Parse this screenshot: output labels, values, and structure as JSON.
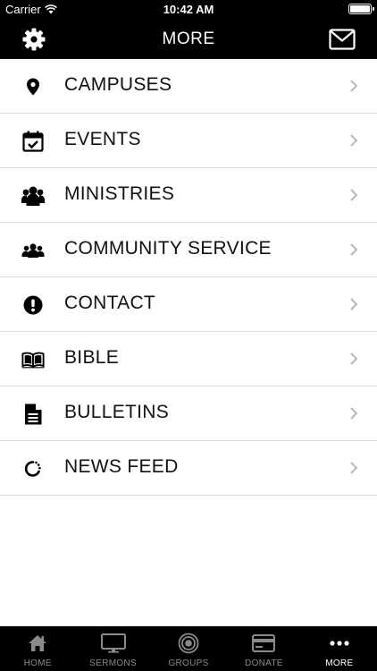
{
  "status": {
    "carrier": "Carrier",
    "time": "10:42 AM"
  },
  "nav": {
    "title": "MORE",
    "left_icon": "gear-icon",
    "right_icon": "mail-icon"
  },
  "menu": {
    "items": [
      {
        "label": "CAMPUSES",
        "icon": "map-pin-icon"
      },
      {
        "label": "EVENTS",
        "icon": "calendar-check-icon"
      },
      {
        "label": "MINISTRIES",
        "icon": "users-group-icon"
      },
      {
        "label": "COMMUNITY SERVICE",
        "icon": "people-icon"
      },
      {
        "label": "CONTACT",
        "icon": "exclamation-circle-icon"
      },
      {
        "label": "BIBLE",
        "icon": "open-book-icon"
      },
      {
        "label": "BULLETINS",
        "icon": "document-icon"
      },
      {
        "label": "NEWS FEED",
        "icon": "refresh-spinner-icon"
      }
    ]
  },
  "tabs": [
    {
      "label": "HOME",
      "icon": "home-icon"
    },
    {
      "label": "SERMONS",
      "icon": "monitor-icon"
    },
    {
      "label": "GROUPS",
      "icon": "target-icon"
    },
    {
      "label": "DONATE",
      "icon": "credit-card-icon"
    },
    {
      "label": "MORE",
      "icon": "ellipsis-icon",
      "active": true
    }
  ],
  "colors": {
    "bar_background": "#000000",
    "active_tab": "#ffffff",
    "inactive_tab": "#8a8a8a",
    "separator": "#dcdcdc",
    "chevron": "#b8b8b8"
  }
}
